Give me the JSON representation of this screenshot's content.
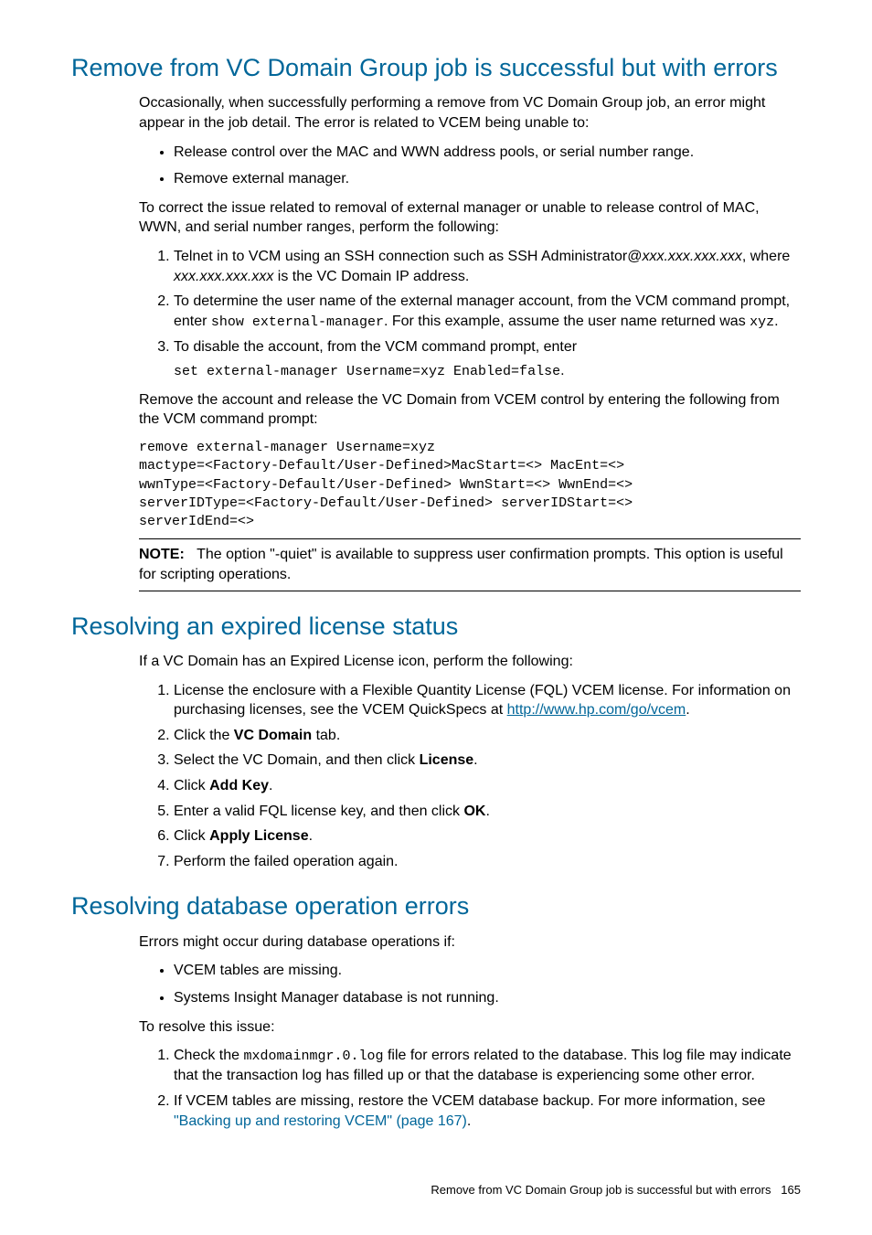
{
  "s1": {
    "heading": "Remove from VC Domain Group job is successful but with errors",
    "p1": "Occasionally, when successfully performing a remove from VC Domain Group job, an error might appear in the job detail. The error is related to VCEM being unable to:",
    "b1": "Release control over the MAC and WWN address pools, or serial number range.",
    "b2": "Remove external manager.",
    "p2": "To correct the issue related to removal of external manager or unable to release control of MAC, WWN, and serial number ranges, perform the following:",
    "o1a": "Telnet in to VCM using an SSH connection such as SSH Administrator@",
    "o1b": "xxx.xxx.xxx.xxx",
    "o1c": ", where ",
    "o1d": "xxx.xxx.xxx.xxx",
    "o1e": " is the VC Domain IP address.",
    "o2a": "To determine the user name of the external manager account, from the VCM command prompt, enter ",
    "o2cmd": "show external-manager",
    "o2b": ". For this example, assume the user name returned was ",
    "o2name": "xyz",
    "o2c": ".",
    "o3a": "To disable the account, from the VCM command prompt, enter",
    "o3cmd": "set external-manager Username=xyz Enabled=false",
    "o3b": ".",
    "p3": "Remove the account and release the VC Domain from VCEM control by entering the following from the VCM command prompt:",
    "codeblock": "remove external-manager Username=xyz\nmactype=<Factory-Default/User-Defined>MacStart=<> MacEnt=<>\nwwnType=<Factory-Default/User-Defined> WwnStart=<> WwnEnd=<>\nserverIDType=<Factory-Default/User-Defined> serverIDStart=<>\nserverIdEnd=<>",
    "note_label": "NOTE:",
    "note_text": "The option \"-quiet\" is available to suppress user confirmation prompts. This option is useful for scripting operations."
  },
  "s2": {
    "heading": "Resolving an expired license status",
    "p1": "If a VC Domain has an Expired License icon, perform the following:",
    "o1a": "License the enclosure with a Flexible Quantity License (FQL) VCEM license. For information on purchasing licenses, see the VCEM QuickSpecs at ",
    "o1link": "http://www.hp.com/go/vcem",
    "o1b": ".",
    "o2a": "Click the ",
    "o2bold": "VC Domain",
    "o2b": " tab.",
    "o3a": "Select the VC Domain, and then click ",
    "o3bold": "License",
    "o3b": ".",
    "o4a": "Click ",
    "o4bold": "Add Key",
    "o4b": ".",
    "o5a": "Enter a valid FQL license key, and then click ",
    "o5bold": "OK",
    "o5b": ".",
    "o6a": "Click ",
    "o6bold": "Apply License",
    "o6b": ".",
    "o7": "Perform the failed operation again."
  },
  "s3": {
    "heading": "Resolving database operation errors",
    "p1": "Errors might occur during database operations if:",
    "b1": "VCEM tables are missing.",
    "b2": "Systems Insight Manager database is not running.",
    "p2": "To resolve this issue:",
    "o1a": "Check the ",
    "o1mono": "mxdomainmgr.0.log",
    "o1b": " file for errors related to the database. This log file may indicate that the transaction log has filled up or that the database is experiencing some other error.",
    "o2a": "If VCEM tables are missing, restore the VCEM database backup. For more information, see ",
    "o2xref": "\"Backing up and restoring VCEM\" (page 167)",
    "o2b": "."
  },
  "footer": {
    "text": "Remove from VC Domain Group job is successful but with errors",
    "page": "165"
  }
}
